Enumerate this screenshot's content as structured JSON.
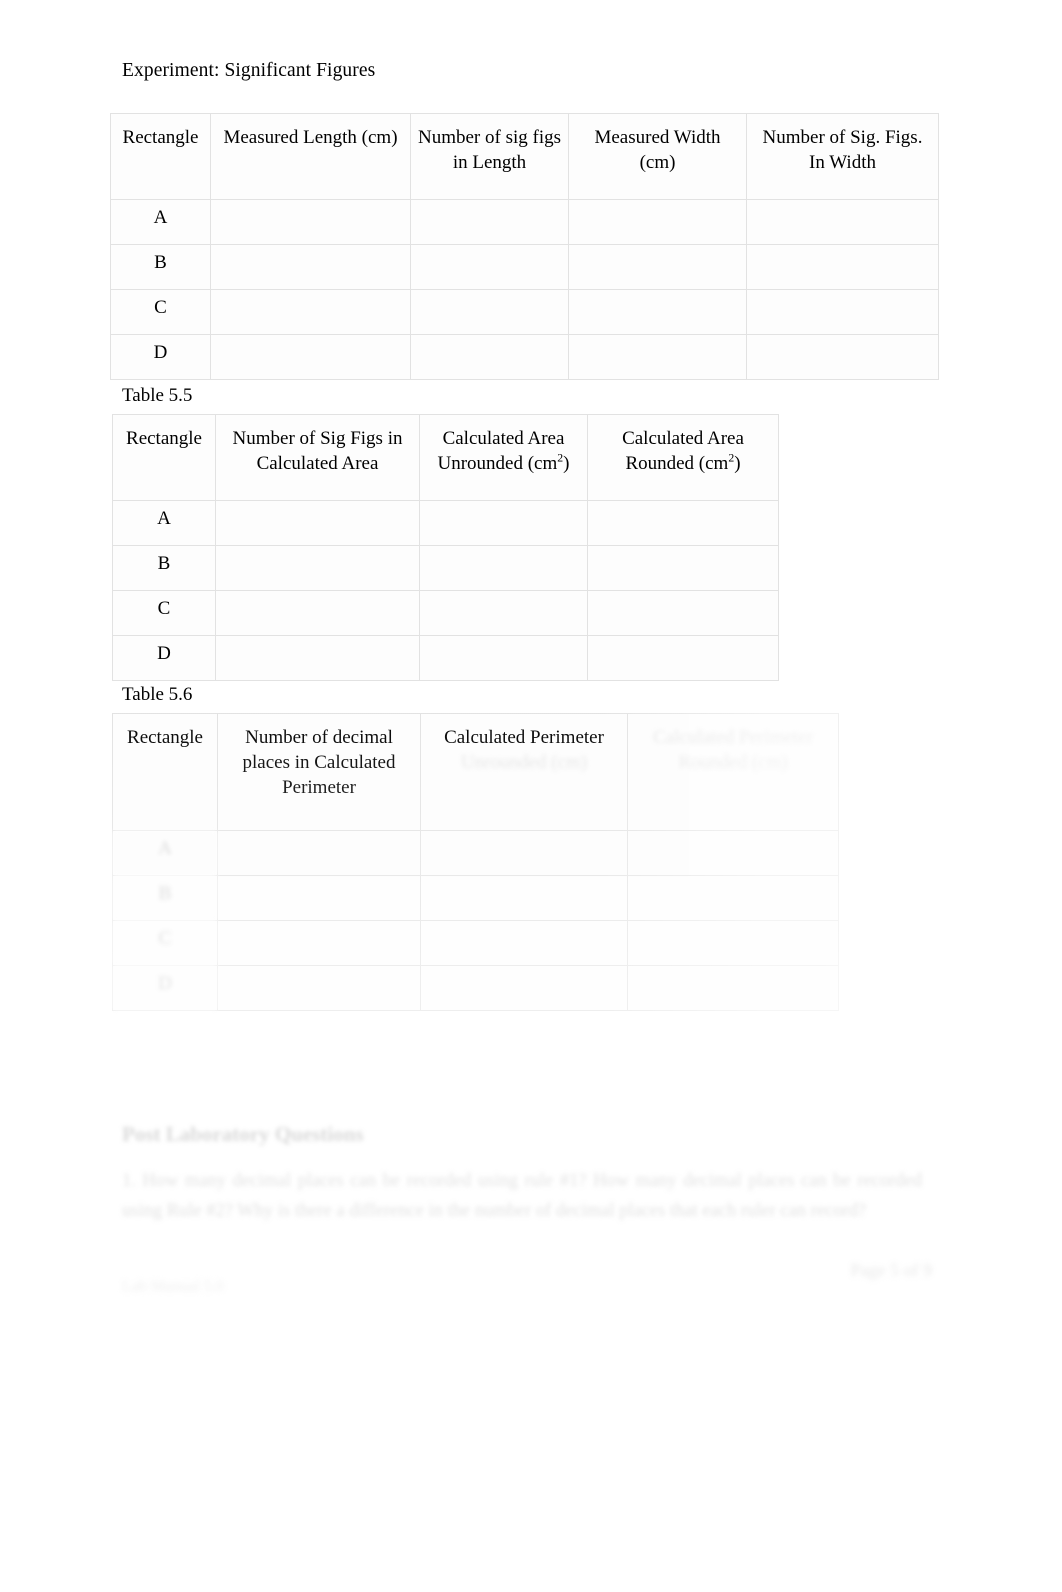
{
  "document": {
    "title": "Experiment: Significant Figures",
    "page_number": "Page 5 of 9",
    "footer_left": "Lab Manual 5.0"
  },
  "tables": [
    {
      "id": "table-54",
      "caption": "",
      "headers": [
        "Rectangle",
        "Measured Length (cm)",
        "Number of sig figs in Length",
        "Measured Width (cm)",
        "Number of Sig. Figs. In Width"
      ],
      "header_lines": [
        [
          "Rectangle"
        ],
        [
          "Measured Length (cm)"
        ],
        [
          "Number of sig figs",
          "in Length"
        ],
        [
          "Measured Width",
          "(cm)"
        ],
        [
          "Number of Sig. Figs.",
          "In Width"
        ]
      ],
      "rows": [
        {
          "label": "A",
          "cells": [
            "",
            "",
            "",
            ""
          ]
        },
        {
          "label": "B",
          "cells": [
            "",
            "",
            "",
            ""
          ]
        },
        {
          "label": "C",
          "cells": [
            "",
            "",
            "",
            ""
          ]
        },
        {
          "label": "D",
          "cells": [
            "",
            "",
            "",
            ""
          ]
        }
      ]
    },
    {
      "id": "table-55",
      "caption": "Table 5.5",
      "headers": [
        "Rectangle",
        "Number of Sig Figs in Calculated Area",
        "Calculated Area Unrounded (cm2)",
        "Calculated Area Rounded (cm2)"
      ],
      "header_lines": [
        [
          "Rectangle"
        ],
        [
          "Number of Sig Figs in",
          "Calculated Area"
        ],
        [
          "Calculated Area",
          "Unrounded (cm2)"
        ],
        [
          "Calculated Area",
          "Rounded (cm2)"
        ]
      ],
      "rows": [
        {
          "label": "A",
          "cells": [
            "",
            "",
            ""
          ]
        },
        {
          "label": "B",
          "cells": [
            "",
            "",
            ""
          ]
        },
        {
          "label": "C",
          "cells": [
            "",
            "",
            ""
          ]
        },
        {
          "label": "D",
          "cells": [
            "",
            "",
            ""
          ]
        }
      ]
    },
    {
      "id": "table-56",
      "caption": "Table 5.6",
      "headers": [
        "Rectangle",
        "Number of decimal places in Calculated Perimeter",
        "Calculated Perimeter Unrounded (cm)",
        "Calculated Perimeter Rounded (cm)"
      ],
      "header_lines": [
        [
          "Rectangle"
        ],
        [
          "Number of decimal",
          "places in Calculated",
          "Perimeter"
        ],
        [
          "Calculated Perimeter",
          "Unrounded (cm)"
        ],
        [
          "Calculated Perimeter",
          "Rounded (cm)"
        ]
      ],
      "rows": [
        {
          "label": "A",
          "cells": [
            "",
            "",
            ""
          ]
        },
        {
          "label": "B",
          "cells": [
            "",
            "",
            ""
          ]
        },
        {
          "label": "C",
          "cells": [
            "",
            "",
            ""
          ]
        },
        {
          "label": "D",
          "cells": [
            "",
            "",
            ""
          ]
        }
      ]
    }
  ],
  "questions": {
    "heading": "Post Laboratory Questions",
    "items": [
      "1.   How many decimal places can be recorded using rule #1? How many decimal places can be recorded using Rule #2? Why is there a difference in the number of decimal places that each ruler can record?"
    ]
  }
}
